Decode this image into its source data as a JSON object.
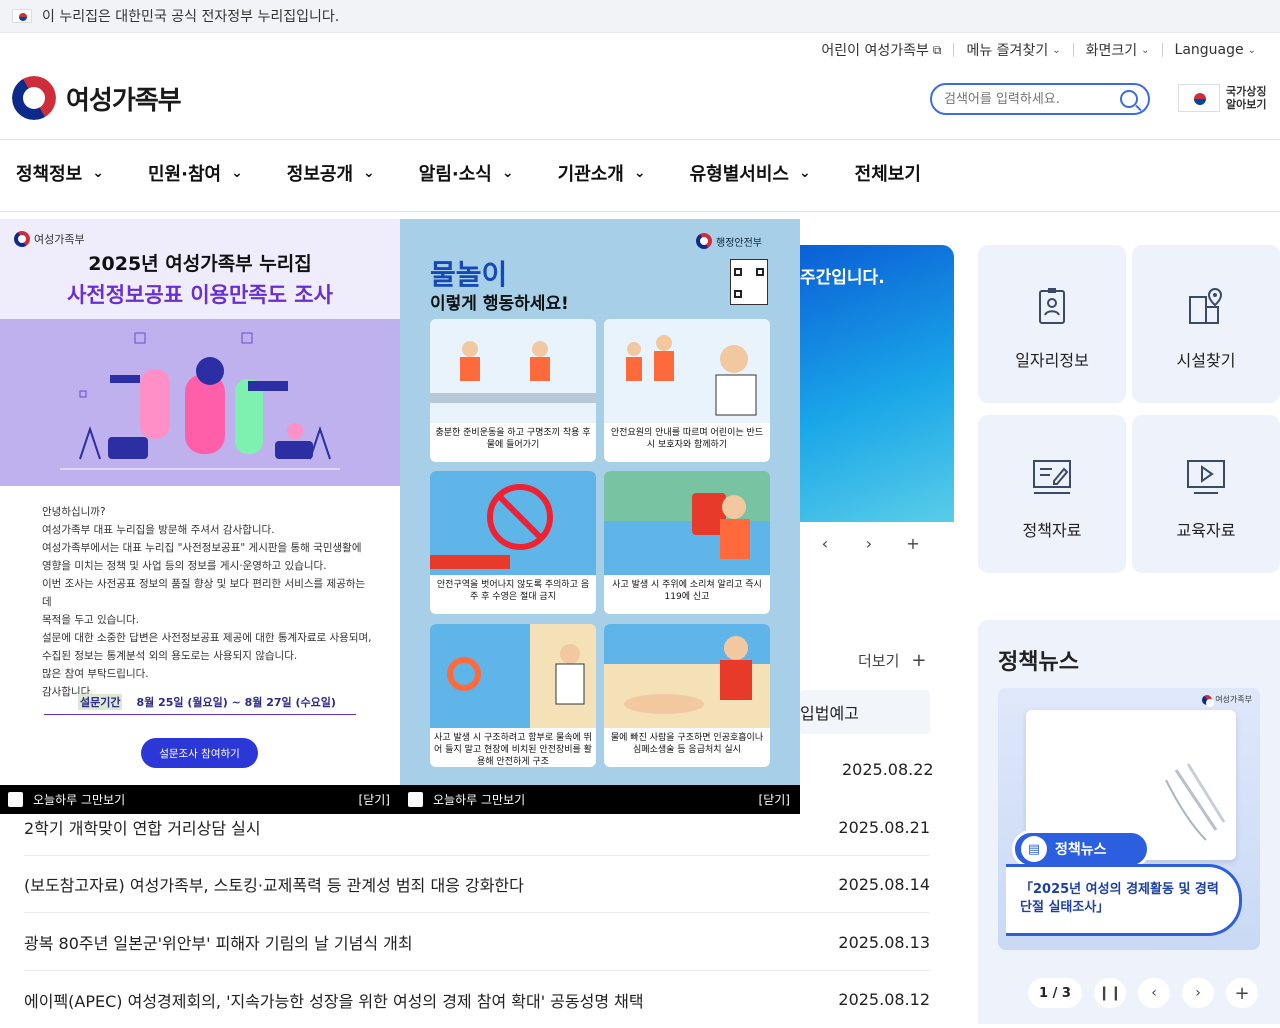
{
  "gov_banner": {
    "text": "이 누리집은 대한민국 공식 전자정부 누리집입니다."
  },
  "utility": {
    "kids": "어린이 여성가족부",
    "favorites": "메뉴 즐겨찾기",
    "font_size": "화면크기",
    "language": "Language"
  },
  "logo": {
    "text": "여성가족부"
  },
  "search": {
    "placeholder": "검색어를 입력하세요."
  },
  "national_symbol": {
    "line1": "국가상징",
    "line2": "알아보기"
  },
  "nav": {
    "items": [
      "정책정보",
      "민원·참여",
      "정보공개",
      "알림·소식",
      "기관소개",
      "유형별서비스",
      "전체보기"
    ]
  },
  "hero": {
    "text": "주간입니다."
  },
  "quick_links": [
    {
      "label": "일자리정보",
      "icon": "id-card-icon"
    },
    {
      "label": "시설찾기",
      "icon": "location-building-icon"
    },
    {
      "label": "정책자료",
      "icon": "document-edit-icon"
    },
    {
      "label": "교육자료",
      "icon": "video-play-icon"
    }
  ],
  "board": {
    "more_label": "더보기",
    "tab_label": "입법예고",
    "rows": [
      {
        "title": "",
        "date": "2025.08.22"
      },
      {
        "title": "2학기 개학맞이 연합 거리상담 실시",
        "date": "2025.08.21"
      },
      {
        "title": "(보도참고자료) 여성가족부, 스토킹·교제폭력 등 관계성 범죄 대응 강화한다",
        "date": "2025.08.14"
      },
      {
        "title": "광복 80주년 일본군'위안부' 피해자 기림의 날 기념식 개최",
        "date": "2025.08.13"
      },
      {
        "title": "에이펙(APEC) 여성경제회의, '지속가능한 성장을 위한 여성의 경제 참여 확대' 공동성명 채택",
        "date": "2025.08.12"
      }
    ]
  },
  "policy_news": {
    "heading": "정책뉴스",
    "badge": "정책뉴스",
    "card_title": "「2025년 여성의 경제활동 및 경력단절 실태조사」",
    "counter": "1 / 3",
    "org": "여성가족부"
  },
  "popup_survey": {
    "org": "여성가족부",
    "title1": "2025년 여성가족부 누리집",
    "title2": "사전정보공표 이용만족도 조사",
    "body": [
      "안녕하십니까?",
      "여성가족부 대표 누리집을 방문해 주셔서 감사합니다.",
      "여성가족부에서는 대표 누리집 \"사전정보공표\" 게시판을 통해 국민생활에",
      "영향을 미치는 정책 및 사업 등의 정보를 게시·운영하고 있습니다.",
      "이번 조사는 사전공표 정보의 품질 향상 및 보다 편리한 서비스를 제공하는데",
      "목적을 두고 있습니다.",
      "설문에 대한 소중한 답변은 사전정보공표 제공에 대한 통계자료로 사용되며,",
      "수집된 정보는 통계분석 외의 용도로는 사용되지 않습니다.",
      "많은 참여 부탁드립니다.",
      "감사합니다."
    ],
    "period_label": "설문기간",
    "period_value": "8월 25일 (월요일) ~ 8월 27일 (수요일)",
    "button": "설문조사 참여하기",
    "dont_show": "오늘하루 그만보기",
    "close": "[닫기]"
  },
  "popup_water": {
    "org": "행정안전부",
    "title1": "물놀이",
    "title2": "이렇게 행동하세요!",
    "captions": [
      "충분한 준비운동을 하고 구명조끼 착용 후 물에 들어가기",
      "안전요원의 안내를 따르며 어린이는 반드시 보호자와 함께하기",
      "안전구역을 벗어나지 않도록 주의하고 음주 후 수영은 절대 금지",
      "사고 발생 시 주위에 소리쳐 알리고 즉시 119에 신고",
      "사고 발생 시 구조하려고 함부로 물속에 뛰어 들지 말고 현장에 비치된 안전장비를 활용해 안전하게 구조",
      "물에 빠진 사람을 구조하면 인공호흡이나 심폐소생술 등 응급처치 실시"
    ],
    "dont_show": "오늘하루 그만보기",
    "close": "[닫기]"
  }
}
